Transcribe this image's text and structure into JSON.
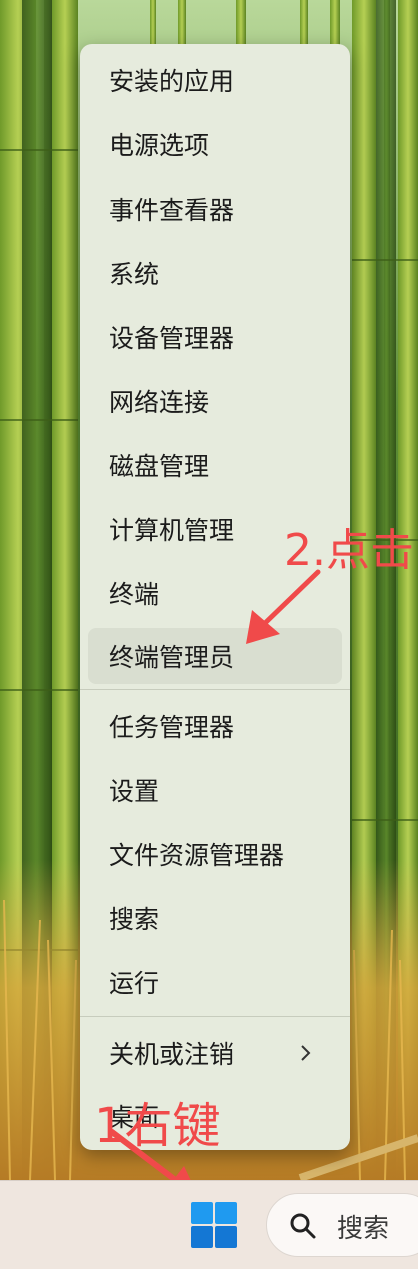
{
  "context_menu": {
    "items": [
      {
        "label": "安装的应用"
      },
      {
        "label": "电源选项"
      },
      {
        "label": "事件查看器"
      },
      {
        "label": "系统"
      },
      {
        "label": "设备管理器"
      },
      {
        "label": "网络连接"
      },
      {
        "label": "磁盘管理"
      },
      {
        "label": "计算机管理"
      },
      {
        "label": "终端"
      },
      {
        "label": "终端管理员",
        "state": "hovered"
      },
      {
        "label": "任务管理器"
      },
      {
        "label": "设置"
      },
      {
        "label": "文件资源管理器"
      },
      {
        "label": "搜索"
      },
      {
        "label": "运行"
      },
      {
        "label": "关机或注销",
        "submenu_icon": "chevron-right-icon"
      },
      {
        "label": "桌面"
      }
    ]
  },
  "annotations": {
    "step2_text": "2.点击",
    "step1_text": "1右键",
    "color": "#f04a4a"
  },
  "taskbar": {
    "start_icon": "windows-logo-icon",
    "search_icon": "search-icon",
    "search_label": "搜索"
  },
  "colors": {
    "menu_background": "#e6ebdd",
    "hover_background": "#d9ded0",
    "taskbar_background": "#efe6df",
    "windows_logo": "#1a8ae8"
  }
}
